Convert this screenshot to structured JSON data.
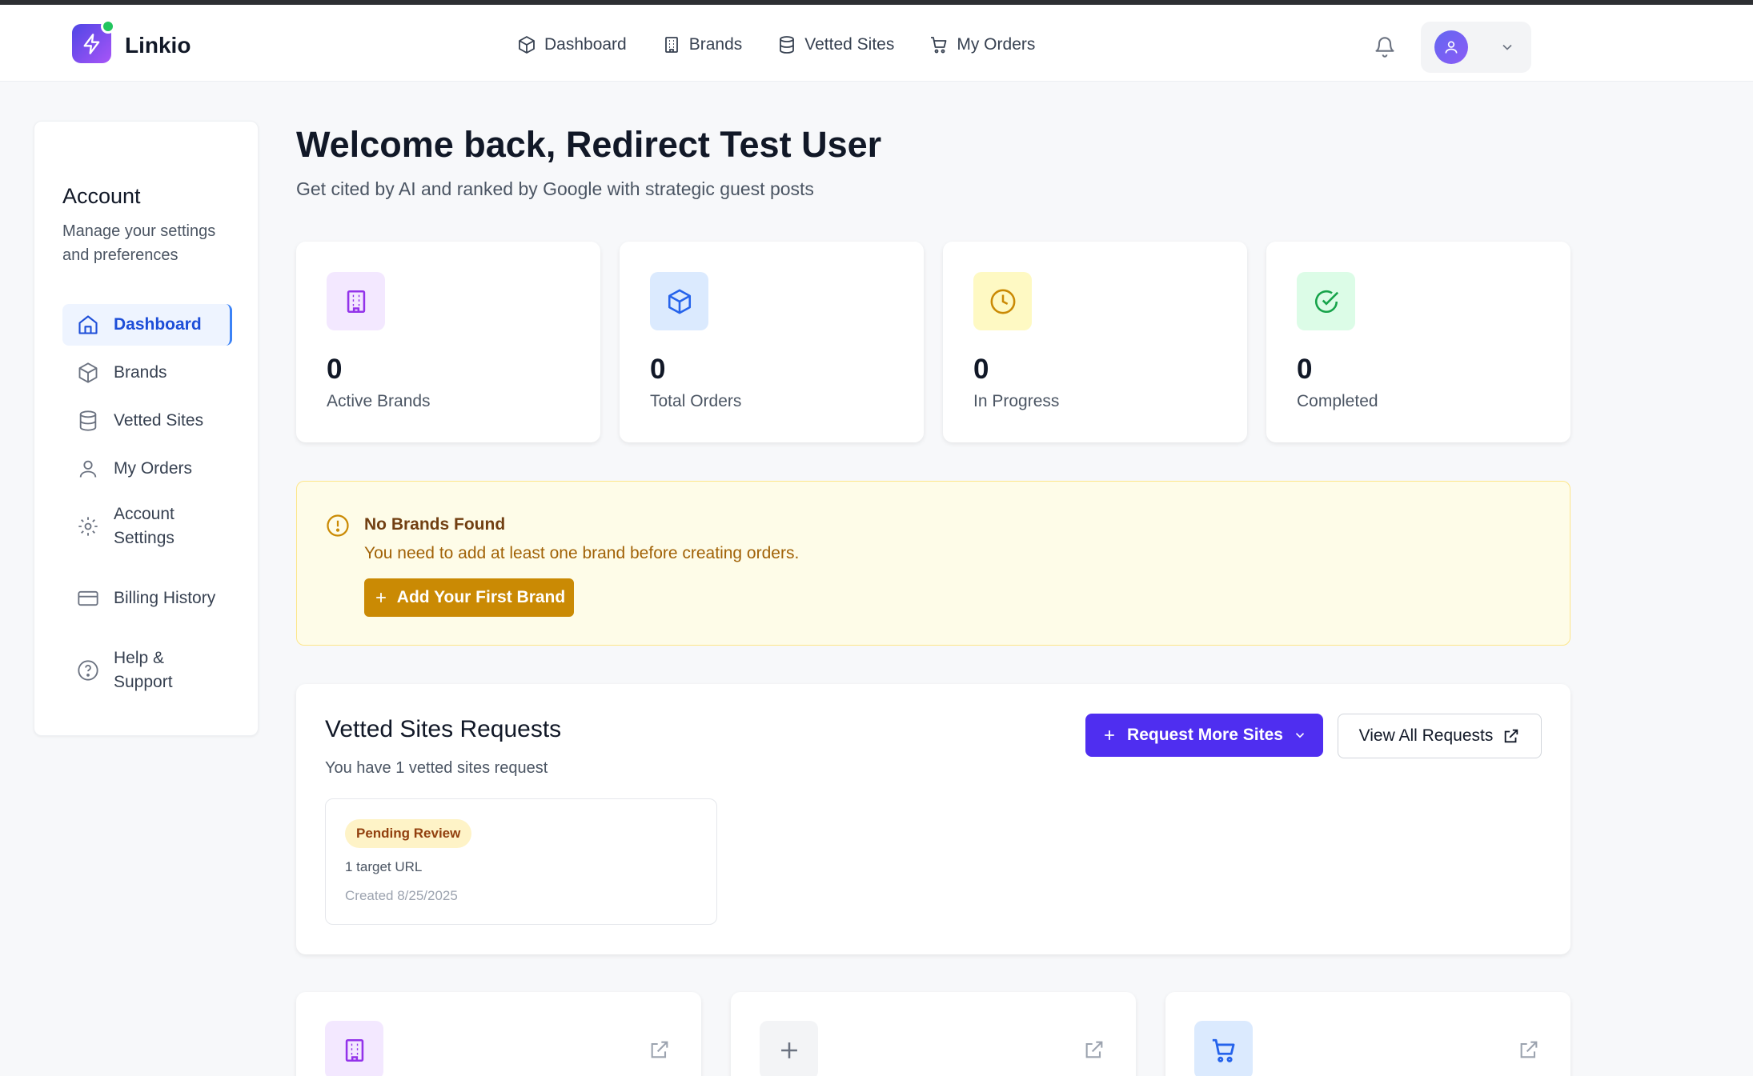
{
  "app": {
    "name": "Linkio"
  },
  "topnav": {
    "items": [
      {
        "label": "Dashboard",
        "icon": "package-icon"
      },
      {
        "label": "Brands",
        "icon": "building-icon"
      },
      {
        "label": "Vetted Sites",
        "icon": "database-icon"
      },
      {
        "label": "My Orders",
        "icon": "cart-icon"
      }
    ]
  },
  "sidebar": {
    "title": "Account",
    "subtitle": "Manage your settings and preferences",
    "items": [
      {
        "label": "Dashboard",
        "icon": "home-icon",
        "active": true
      },
      {
        "label": "Brands",
        "icon": "package-icon"
      },
      {
        "label": "Vetted Sites",
        "icon": "database-icon"
      },
      {
        "label": "My Orders",
        "icon": "user-icon"
      },
      {
        "label": "Account Settings",
        "icon": "gear-icon"
      },
      {
        "label": "Billing History",
        "icon": "credit-card-icon"
      },
      {
        "label": "Help & Support",
        "icon": "help-circle-icon"
      }
    ]
  },
  "main": {
    "welcome": "Welcome back, Redirect Test User",
    "tagline": "Get cited by AI and ranked by Google with strategic guest posts"
  },
  "stats": [
    {
      "value": "0",
      "label": "Active Brands",
      "icon": "building-icon",
      "color": "#9333ea",
      "bg": "#f3e8ff"
    },
    {
      "value": "0",
      "label": "Total Orders",
      "icon": "package-icon",
      "color": "#2563eb",
      "bg": "#dbeafe"
    },
    {
      "value": "0",
      "label": "In Progress",
      "icon": "clock-icon",
      "color": "#ca8a04",
      "bg": "#fef9c3"
    },
    {
      "value": "0",
      "label": "Completed",
      "icon": "check-circle-icon",
      "color": "#16a34a",
      "bg": "#dcfce7"
    }
  ],
  "alert": {
    "title": "No Brands Found",
    "text": "You need to add at least one brand before creating orders.",
    "button": "Add Your First Brand"
  },
  "vetted": {
    "title": "Vetted Sites Requests",
    "subtitle": "You have 1 vetted sites request",
    "request_button": "Request More Sites",
    "view_button": "View All Requests",
    "request": {
      "status": "Pending Review",
      "targets": "1 target URL",
      "created": "Created 8/25/2025"
    }
  },
  "quick_actions": [
    {
      "icon": "building-icon",
      "color": "#9333ea",
      "bg": "#f3e8ff"
    },
    {
      "icon": "plus-icon",
      "color": "#6b7280",
      "bg": "#f3f4f6"
    },
    {
      "icon": "cart-icon",
      "color": "#2563eb",
      "bg": "#dbeafe"
    }
  ],
  "colors": {
    "primary": "#4f2ef0",
    "active_nav": "#1d4ed8",
    "warning": "#ca8a04"
  }
}
